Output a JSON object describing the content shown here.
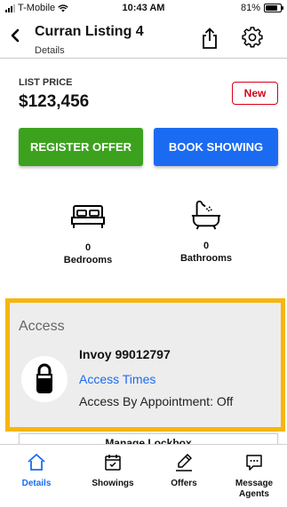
{
  "status_bar": {
    "carrier": "T-Mobile",
    "time": "10:43 AM",
    "battery": "81%",
    "battery_level": 0.81
  },
  "header": {
    "title": "Curran Listing 4",
    "subtitle": "Details"
  },
  "listing": {
    "price_label": "LIST PRICE",
    "price": "$123,456",
    "badge": "New"
  },
  "actions": {
    "register": "REGISTER OFFER",
    "book": "BOOK SHOWING"
  },
  "features": [
    {
      "icon": "bed-icon",
      "count": "0",
      "label": "Bedrooms"
    },
    {
      "icon": "bathtub-icon",
      "count": "0",
      "label": "Bathrooms"
    }
  ],
  "access": {
    "title": "Access",
    "device": "Invoy 99012797",
    "times_link": "Access Times",
    "appointment": "Access By Appointment: Off"
  },
  "lockbox": {
    "manage_label": "Manage Lockbox"
  },
  "tabs": [
    {
      "icon": "home-icon",
      "label": "Details",
      "active": true
    },
    {
      "icon": "calendar-icon",
      "label": "Showings",
      "active": false
    },
    {
      "icon": "signature-icon",
      "label": "Offers",
      "active": false
    },
    {
      "icon": "chat-icon",
      "label": "Message Agents",
      "active": false
    }
  ],
  "colors": {
    "accent": "#1b6bf2",
    "register": "#3ca21e",
    "badge": "#d4001a",
    "highlight": "#f6b60f"
  }
}
